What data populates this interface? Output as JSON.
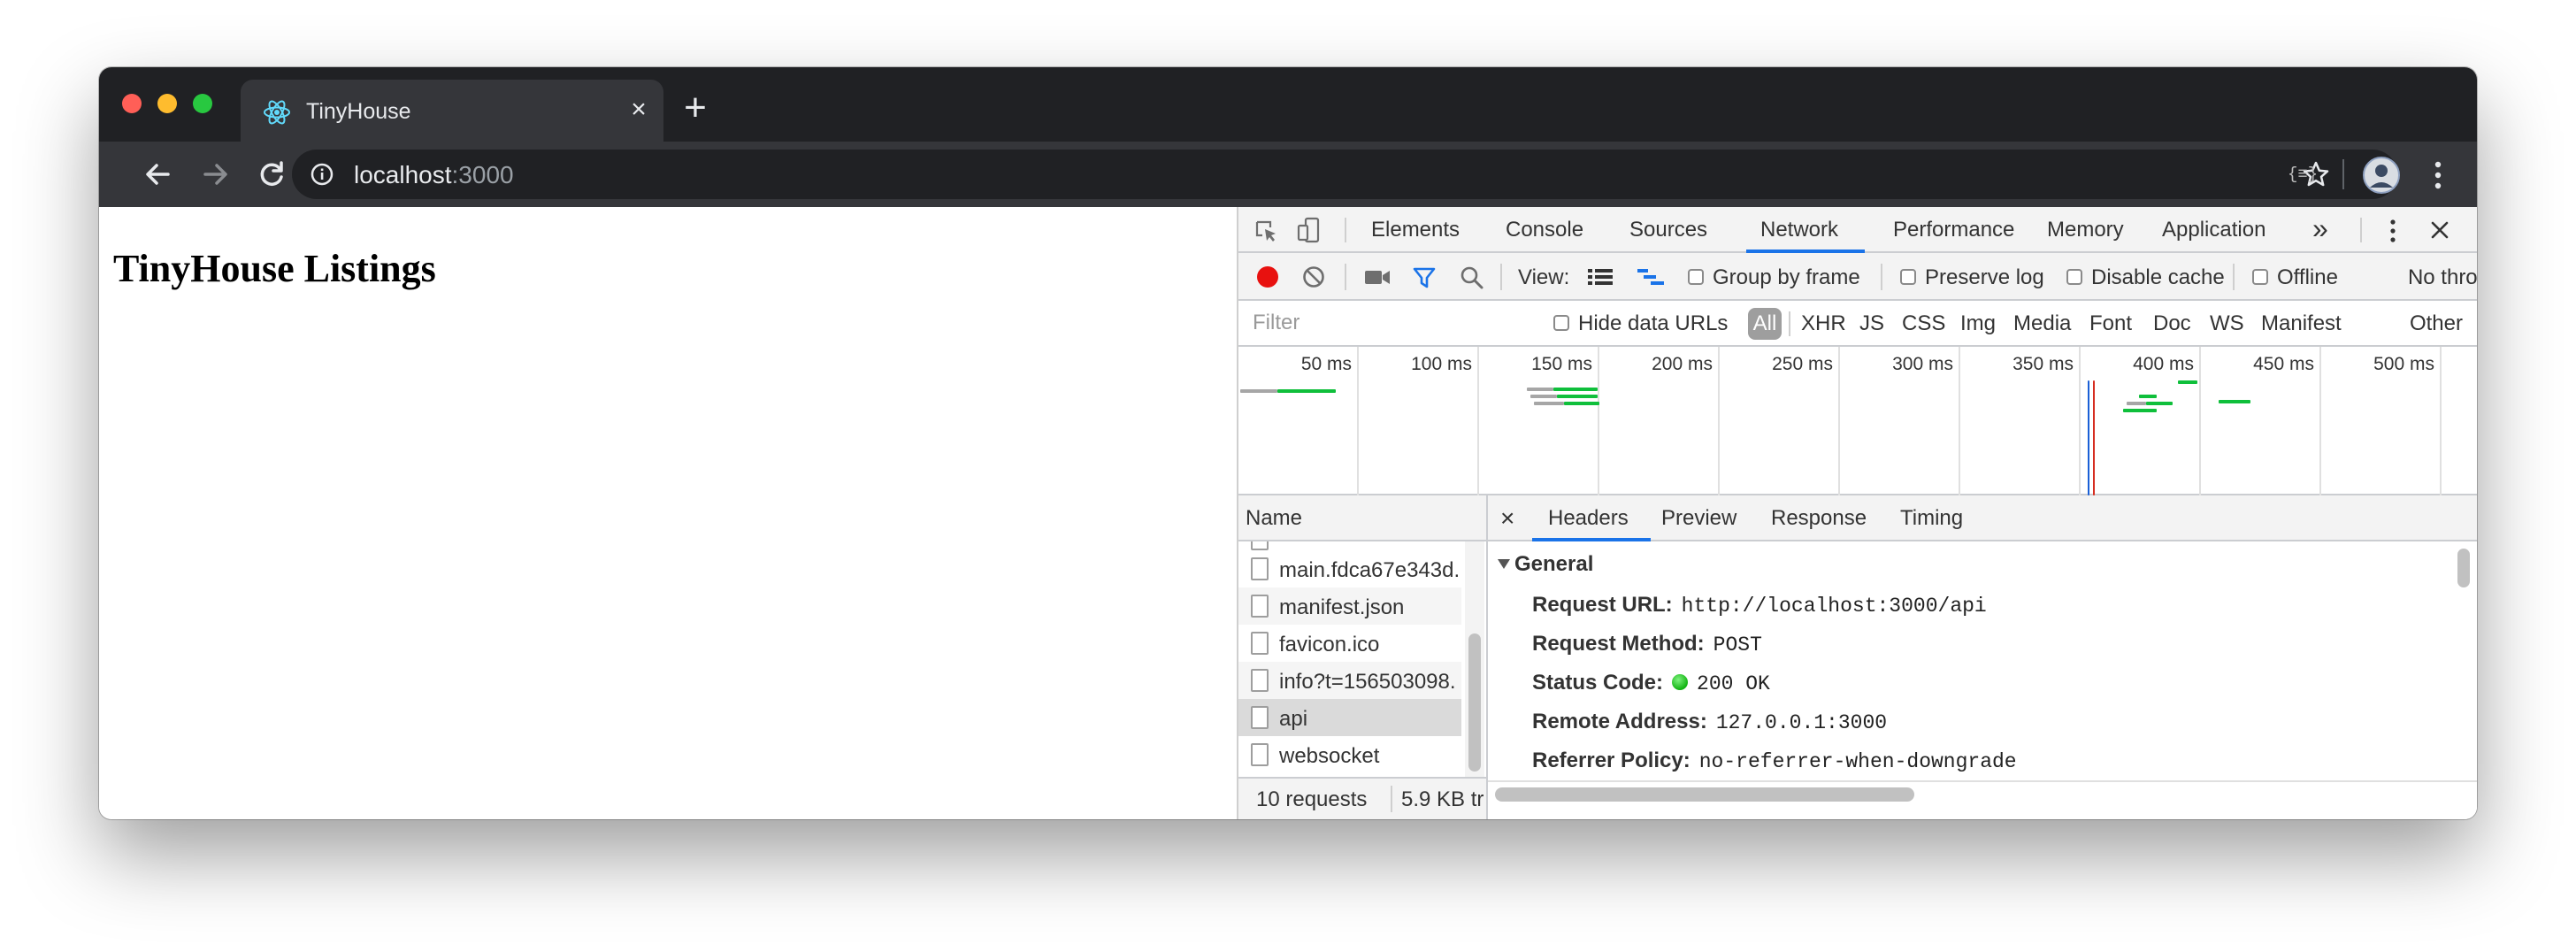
{
  "browser": {
    "tab_title": "TinyHouse",
    "new_tab_symbol": "+",
    "close_symbol": "×",
    "url_host": "localhost",
    "url_port": ":3000",
    "extension_label": "{≡}"
  },
  "page": {
    "heading": "TinyHouse Listings"
  },
  "devtools": {
    "tabs": [
      "Elements",
      "Console",
      "Sources",
      "Network",
      "Performance",
      "Memory",
      "Application"
    ],
    "active_tab": "Network",
    "more_tabs": "»",
    "toolbar": {
      "view_label": "View:",
      "group_by_frame": "Group by frame",
      "preserve_log": "Preserve log",
      "disable_cache": "Disable cache",
      "offline": "Offline",
      "throttling": "No thrott"
    },
    "filter": {
      "placeholder": "Filter",
      "hide_data_urls": "Hide data URLs",
      "types": [
        "All",
        "XHR",
        "JS",
        "CSS",
        "Img",
        "Media",
        "Font",
        "Doc",
        "WS",
        "Manifest",
        "Other"
      ]
    },
    "timeline": {
      "ticks": [
        "50 ms",
        "100 ms",
        "150 ms",
        "200 ms",
        "250 ms",
        "300 ms",
        "350 ms",
        "400 ms",
        "450 ms",
        "500 ms"
      ]
    },
    "requests": {
      "column_header": "Name",
      "items": [
        {
          "name": "main.fdca67e343d.",
          "selected": false
        },
        {
          "name": "manifest.json",
          "selected": false
        },
        {
          "name": "favicon.ico",
          "selected": false
        },
        {
          "name": "info?t=156503098.",
          "selected": false
        },
        {
          "name": "api",
          "selected": true
        },
        {
          "name": "websocket",
          "selected": false
        }
      ],
      "summary_count": "10 requests",
      "summary_size": "5.9 KB tr"
    },
    "details": {
      "close_symbol": "×",
      "tabs": [
        "Headers",
        "Preview",
        "Response",
        "Timing"
      ],
      "active_tab": "Headers",
      "section_title": "General",
      "headers": [
        {
          "key": "Request URL:",
          "value": "http://localhost:3000/api"
        },
        {
          "key": "Request Method:",
          "value": "POST"
        },
        {
          "key": "Status Code:",
          "value": "200 OK",
          "status_dot": true
        },
        {
          "key": "Remote Address:",
          "value": "127.0.0.1:3000"
        },
        {
          "key": "Referrer Policy:",
          "value": "no-referrer-when-downgrade"
        }
      ]
    }
  },
  "colors": {
    "tabstrip": "#202124",
    "toolbar": "#35363a",
    "close_light": "#ff5f57",
    "minimize_light": "#febc2e",
    "zoom_light": "#28c840",
    "record": "#e8110f",
    "accent_blue": "#1a73e8",
    "waterfall_green": "#0fbf3b",
    "waterfall_gray": "#a6a6a6",
    "dom_content_loaded": "#1a5fd6",
    "load_event": "#d62d20"
  }
}
